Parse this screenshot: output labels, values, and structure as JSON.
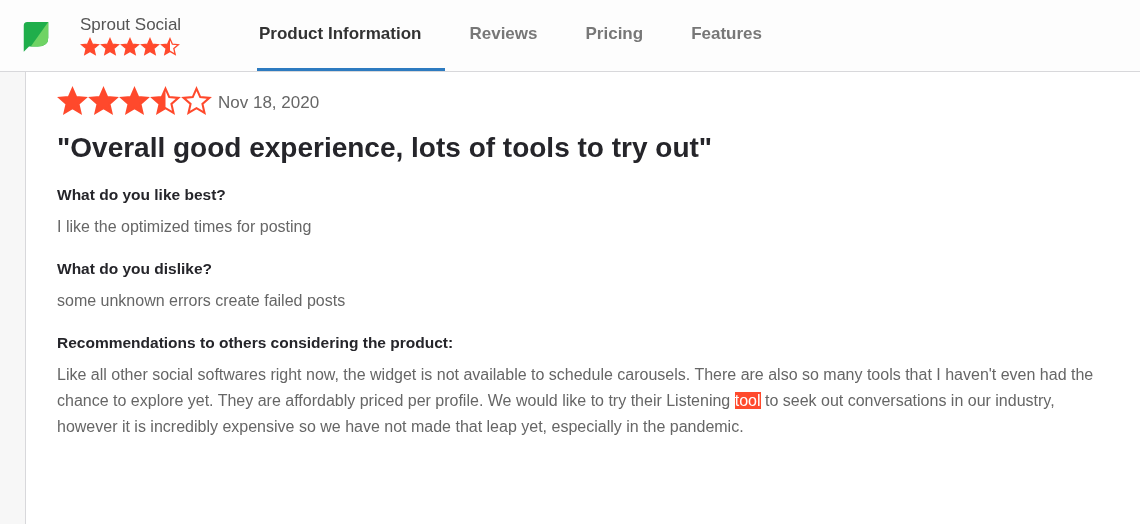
{
  "product": {
    "name": "Sprout Social",
    "stars": 4.5
  },
  "tabs": [
    {
      "label": "Product Information",
      "selected": true
    },
    {
      "label": "Reviews",
      "selected": false
    },
    {
      "label": "Pricing",
      "selected": false
    },
    {
      "label": "Features",
      "selected": false
    }
  ],
  "review": {
    "stars": 3.5,
    "date": "Nov 18, 2020",
    "title": "\"Overall good experience, lots of tools to try out\"",
    "sections": [
      {
        "question": "What do you like best?",
        "answer": [
          {
            "text": "I like the optimized times for posting",
            "highlighted": false
          }
        ]
      },
      {
        "question": "What do you dislike?",
        "answer": [
          {
            "text": "some unknown errors create failed posts",
            "highlighted": false
          }
        ]
      },
      {
        "question": "Recommendations to others considering the product:",
        "answer": [
          {
            "text": "Like all other social softwares right now, the widget is not available to schedule carousels. There are also so many tools that I haven't even had the chance to explore yet. They are affordably priced per profile. We would like to try their Listening ",
            "highlighted": false
          },
          {
            "text": "tool",
            "highlighted": true
          },
          {
            "text": " to seek out conversations in our industry, however it is incredibly expensive so we have not made that leap yet, especially in the pandemic.",
            "highlighted": false
          }
        ]
      }
    ]
  }
}
